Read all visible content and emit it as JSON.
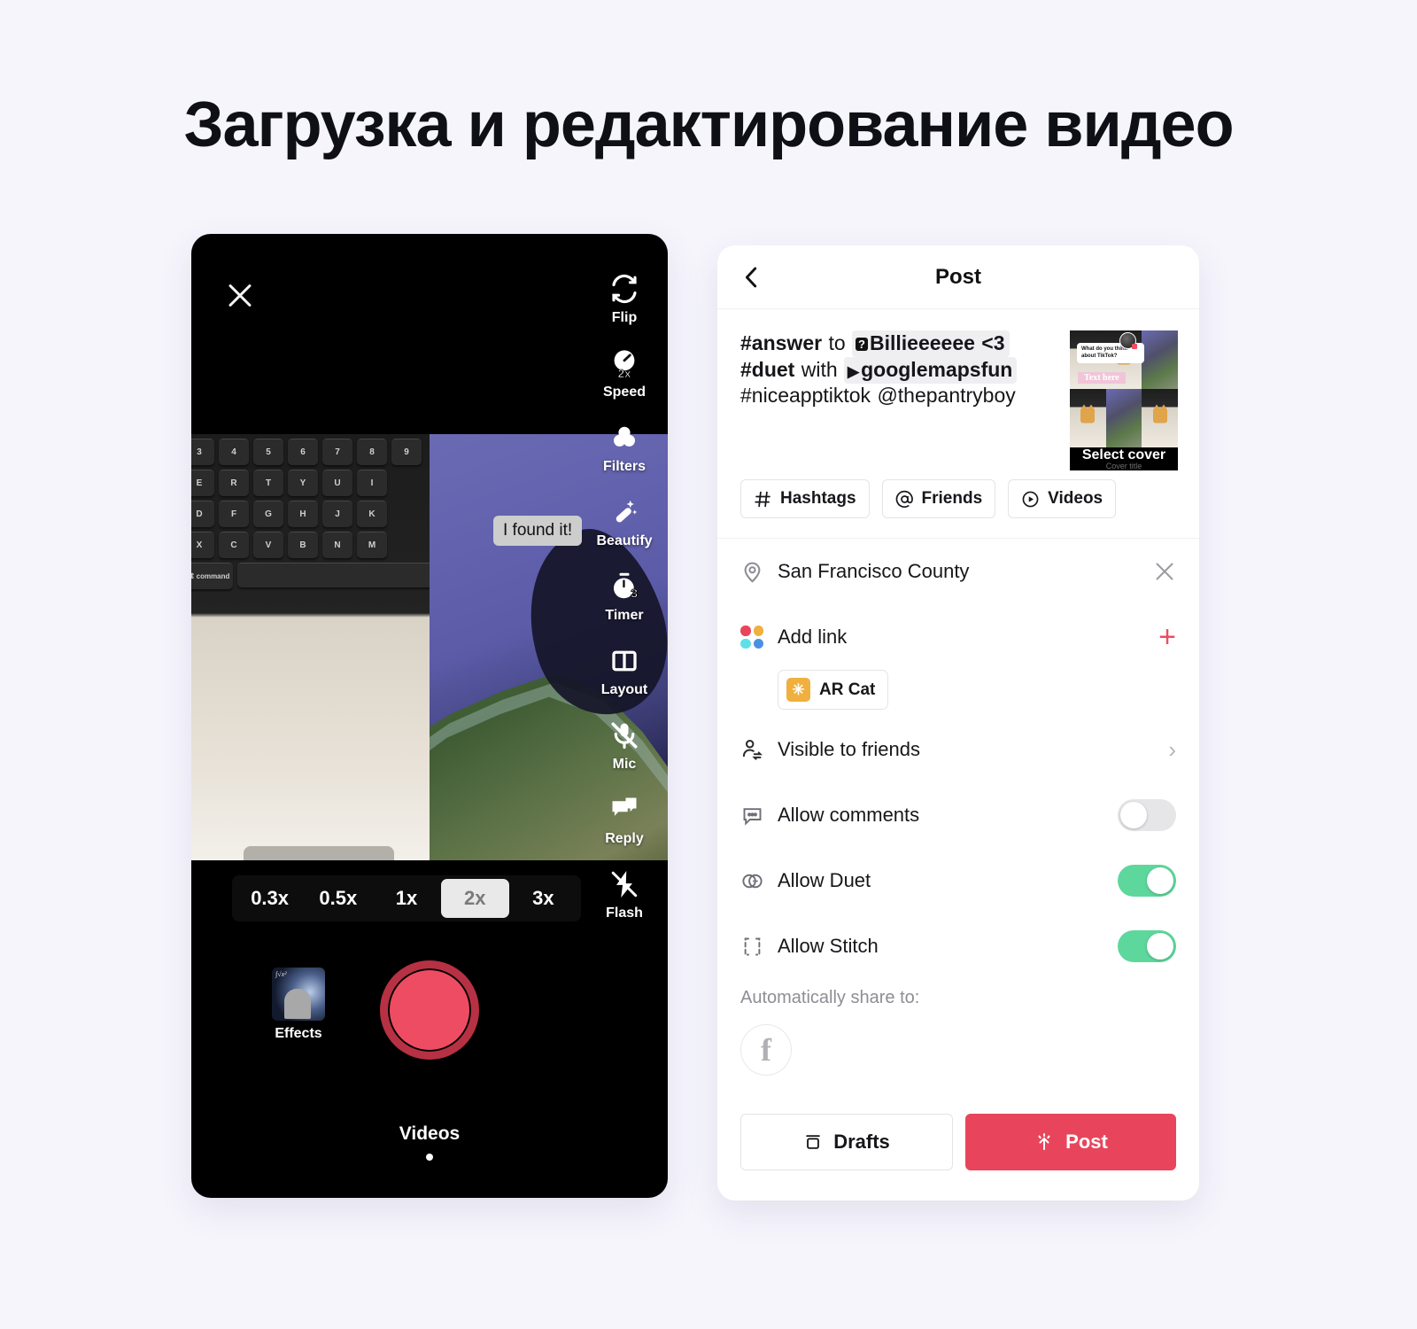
{
  "page": {
    "title": "Загрузка и редактирование видео",
    "background_color": "#F6F5FC",
    "accent_red": "#E8455C",
    "toggle_green": "#5ED79C"
  },
  "camera": {
    "close_icon": "close-icon",
    "overlay_sticker": "I found it!",
    "toolbar": [
      {
        "icon": "flip-camera-icon",
        "label": "Flip"
      },
      {
        "icon": "speedometer-icon",
        "label": "Speed",
        "badge": "2x"
      },
      {
        "icon": "filters-icon",
        "label": "Filters"
      },
      {
        "icon": "magic-wand-icon",
        "label": "Beautify"
      },
      {
        "icon": "timer-icon",
        "label": "Timer",
        "badge": "3"
      },
      {
        "icon": "layout-icon",
        "label": "Layout"
      },
      {
        "icon": "mic-muted-icon",
        "label": "Mic"
      },
      {
        "icon": "reply-icon",
        "label": "Reply"
      },
      {
        "icon": "flash-off-icon",
        "label": "Flash"
      }
    ],
    "speed_options": [
      "0.3x",
      "0.5x",
      "1x",
      "2x",
      "3x"
    ],
    "speed_selected": "2x",
    "effects_label": "Effects",
    "record_button": "record-button",
    "bottom_tab": "Videos",
    "keyboard_rows": [
      [
        "3",
        "4",
        "5",
        "6",
        "7",
        "8",
        "9"
      ],
      [
        "E",
        "R",
        "T",
        "Y",
        "U",
        "I"
      ],
      [
        "D",
        "F",
        "G",
        "H",
        "J",
        "K"
      ],
      [
        "X",
        "C",
        "V",
        "B",
        "N",
        "M"
      ]
    ],
    "command_key": "⌘ command"
  },
  "post": {
    "header_title": "Post",
    "back_icon": "back-chevron-icon",
    "caption": {
      "tag_answer": "#answer",
      "word_to": "to",
      "mention_chip": "Billieeeeee <3",
      "tag_duet": "#duet",
      "word_with": "with",
      "video_chip": "googlemapsfun",
      "tag_nice": "#niceapptiktok",
      "mention_user": "@thepantryboy"
    },
    "cover": {
      "bubble_text": "What do you think about TikTok?",
      "text_sticker": "Text here",
      "select_cover": "Select cover",
      "cover_title": "Cover title"
    },
    "chips": [
      {
        "icon": "hashtag-icon",
        "label": "Hashtags"
      },
      {
        "icon": "at-icon",
        "label": "Friends"
      },
      {
        "icon": "play-circle-icon",
        "label": "Videos"
      }
    ],
    "location": {
      "icon": "location-pin-icon",
      "label": "San Francisco County",
      "clear_icon": "close-icon"
    },
    "add_link": {
      "icon": "four-dots-icon",
      "label": "Add link",
      "add_icon": "plus-icon",
      "dot_colors": [
        "#E8455C",
        "#F0B03F",
        "#5FE0E8",
        "#4A90E2"
      ],
      "item": {
        "icon": "ar-sparkle-icon",
        "label": "AR Cat"
      }
    },
    "visibility": {
      "icon": "person-switch-icon",
      "label": "Visible to friends",
      "chevron": "chevron-right-icon"
    },
    "toggles": [
      {
        "icon": "comment-icon",
        "label": "Allow comments",
        "on": false
      },
      {
        "icon": "duet-icon",
        "label": "Allow Duet",
        "on": true
      },
      {
        "icon": "stitch-icon",
        "label": "Allow Stitch",
        "on": true
      }
    ],
    "share": {
      "label": "Automatically share to:",
      "networks": [
        {
          "icon": "facebook-icon",
          "glyph": "f"
        }
      ]
    },
    "actions": {
      "drafts": {
        "icon": "drafts-icon",
        "label": "Drafts"
      },
      "post": {
        "icon": "upload-icon",
        "label": "Post"
      }
    }
  }
}
